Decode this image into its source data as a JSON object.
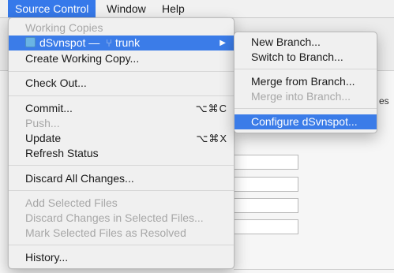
{
  "menubar": {
    "items": [
      {
        "label": "Source Control",
        "active": true
      },
      {
        "label": "Window",
        "active": false
      },
      {
        "label": "Help",
        "active": false
      }
    ]
  },
  "background": {
    "visible_fragment": "es"
  },
  "source_control_menu": {
    "section_header": "Working Copies",
    "working_copy": {
      "name": "dSvnspot",
      "dash": "—",
      "branch": "trunk",
      "icon": "folder-icon",
      "branch_icon": "branch-icon"
    },
    "create_working_copy": "Create Working Copy...",
    "check_out": "Check Out...",
    "commit": {
      "label": "Commit...",
      "shortcut": "⌥⌘C"
    },
    "push": "Push...",
    "update": {
      "label": "Update",
      "shortcut": "⌥⌘X"
    },
    "refresh_status": "Refresh Status",
    "discard_all": "Discard All Changes...",
    "add_selected": "Add Selected Files",
    "discard_selected": "Discard Changes in Selected Files...",
    "mark_resolved": "Mark Selected Files as Resolved",
    "history": "History..."
  },
  "submenu": {
    "new_branch": "New Branch...",
    "switch_branch": "Switch to Branch...",
    "merge_from": "Merge from Branch...",
    "merge_into": "Merge into Branch...",
    "configure": "Configure dSvnspot..."
  },
  "colors": {
    "highlight": "#3b7ce8",
    "menubar_active": "#3679ea",
    "disabled_text": "#a7a7a7"
  }
}
